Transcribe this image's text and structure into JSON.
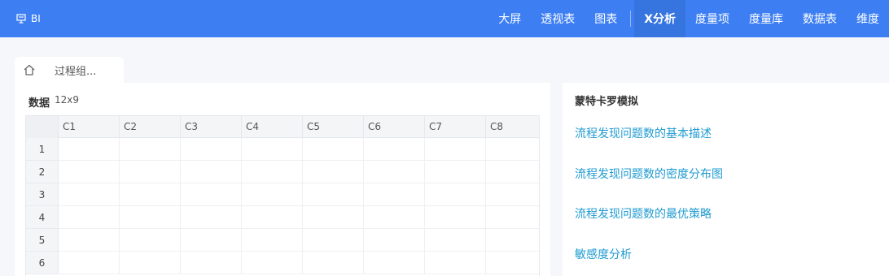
{
  "topbar": {
    "brand": "BI",
    "nav": [
      "大屏",
      "透视表",
      "图表",
      "X分析",
      "度量项",
      "度量库",
      "数据表",
      "维度"
    ],
    "active": "X分析"
  },
  "tab": {
    "label": "过程组..."
  },
  "data_panel": {
    "title": "数据",
    "dims": "12x9",
    "columns": [
      "C1",
      "C2",
      "C3",
      "C4",
      "C5",
      "C6",
      "C7",
      "C8"
    ],
    "rows": [
      "1",
      "2",
      "3",
      "4",
      "5",
      "6"
    ]
  },
  "sim_panel": {
    "title": "蒙特卡罗模拟",
    "links": [
      "流程发现问题数的基本描述",
      "流程发现问题数的密度分布图",
      "流程发现问题数的最优策略",
      "敏感度分析"
    ]
  }
}
